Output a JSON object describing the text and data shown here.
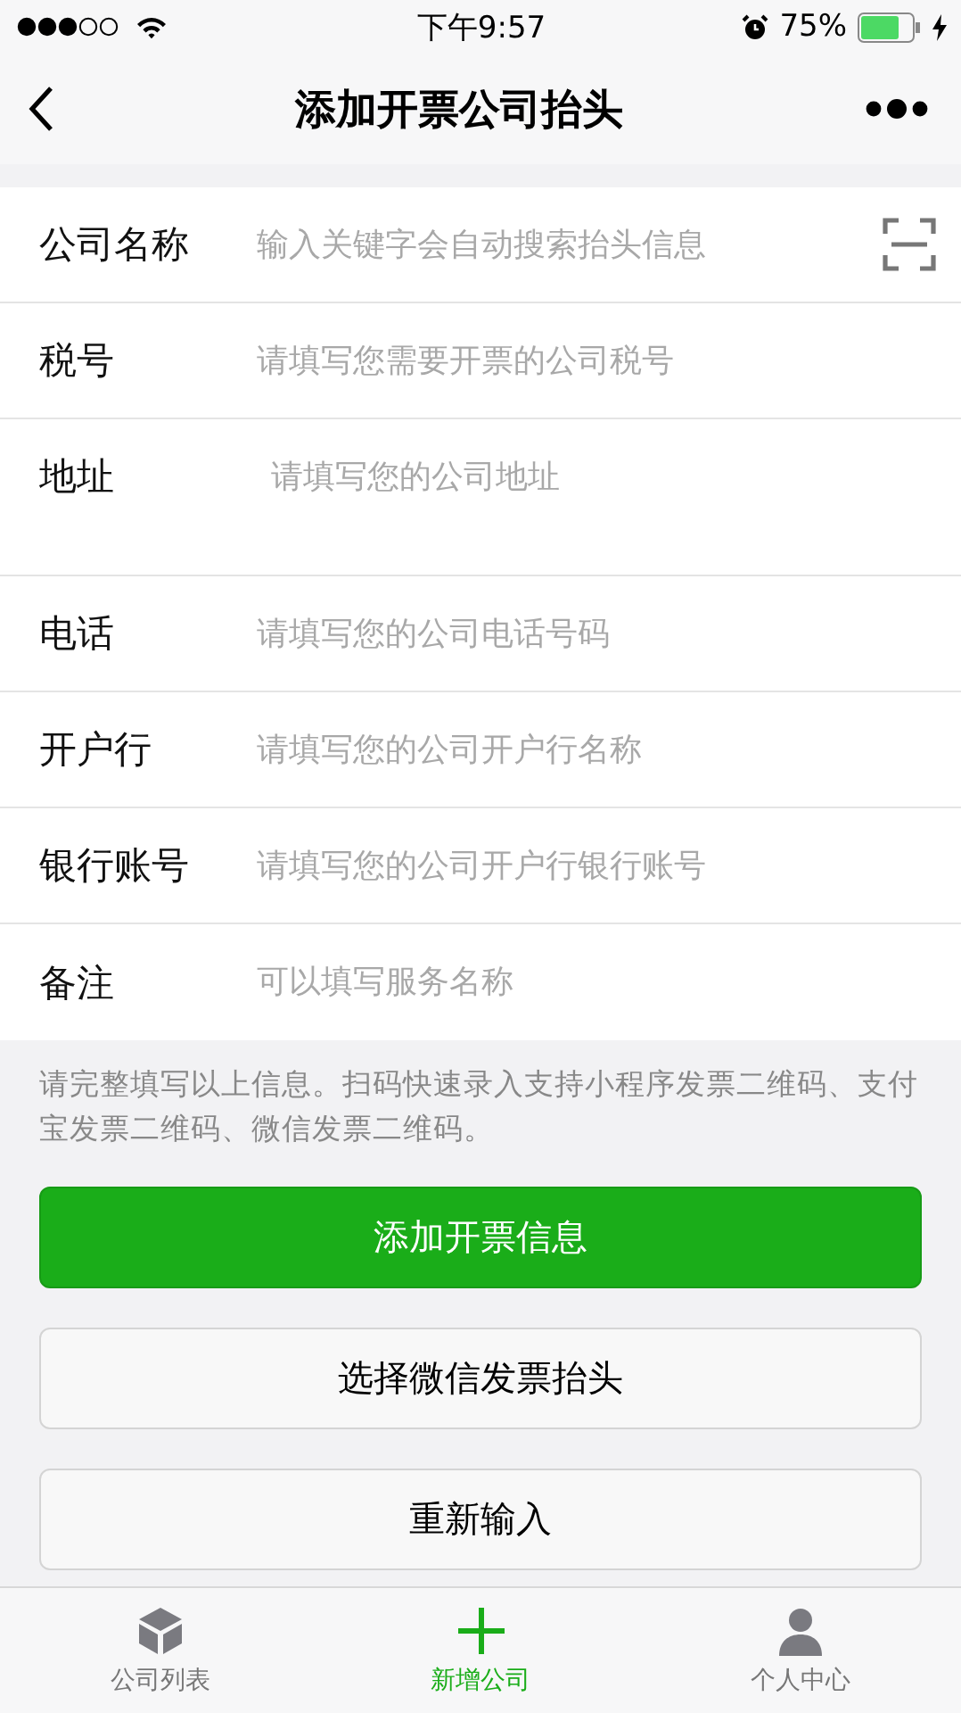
{
  "status_bar": {
    "time": "下午9:57",
    "battery": "75%"
  },
  "nav": {
    "title": "添加开票公司抬头"
  },
  "fields": [
    {
      "kind": "scan",
      "label": "公司名称",
      "placeholder": "输入关键字会自动搜索抬头信息"
    },
    {
      "kind": "text",
      "label": "税号",
      "placeholder": "请填写您需要开票的公司税号"
    },
    {
      "kind": "textarea",
      "label": "地址",
      "placeholder": "请填写您的公司地址"
    },
    {
      "kind": "text",
      "label": "电话",
      "placeholder": "请填写您的公司电话号码"
    },
    {
      "kind": "text",
      "label": "开户行",
      "placeholder": "请填写您的公司开户行名称"
    },
    {
      "kind": "text",
      "label": "银行账号",
      "placeholder": "请填写您的公司开户行银行账号"
    },
    {
      "kind": "text",
      "label": "备注",
      "placeholder": "可以填写服务名称"
    }
  ],
  "note": "请完整填写以上信息。扫码快速录入支持小程序发票二维码、支付宝发票二维码、微信发票二维码。",
  "buttons": [
    {
      "kind": "primary",
      "label": "添加开票信息"
    },
    {
      "kind": "default",
      "label": "选择微信发票抬头"
    },
    {
      "kind": "default",
      "label": "重新输入"
    }
  ],
  "tabs": [
    {
      "kind": "cube",
      "label": "公司列表",
      "selected": false
    },
    {
      "kind": "plus",
      "label": "新增公司",
      "selected": true
    },
    {
      "kind": "person",
      "label": "个人中心",
      "selected": false
    }
  ]
}
